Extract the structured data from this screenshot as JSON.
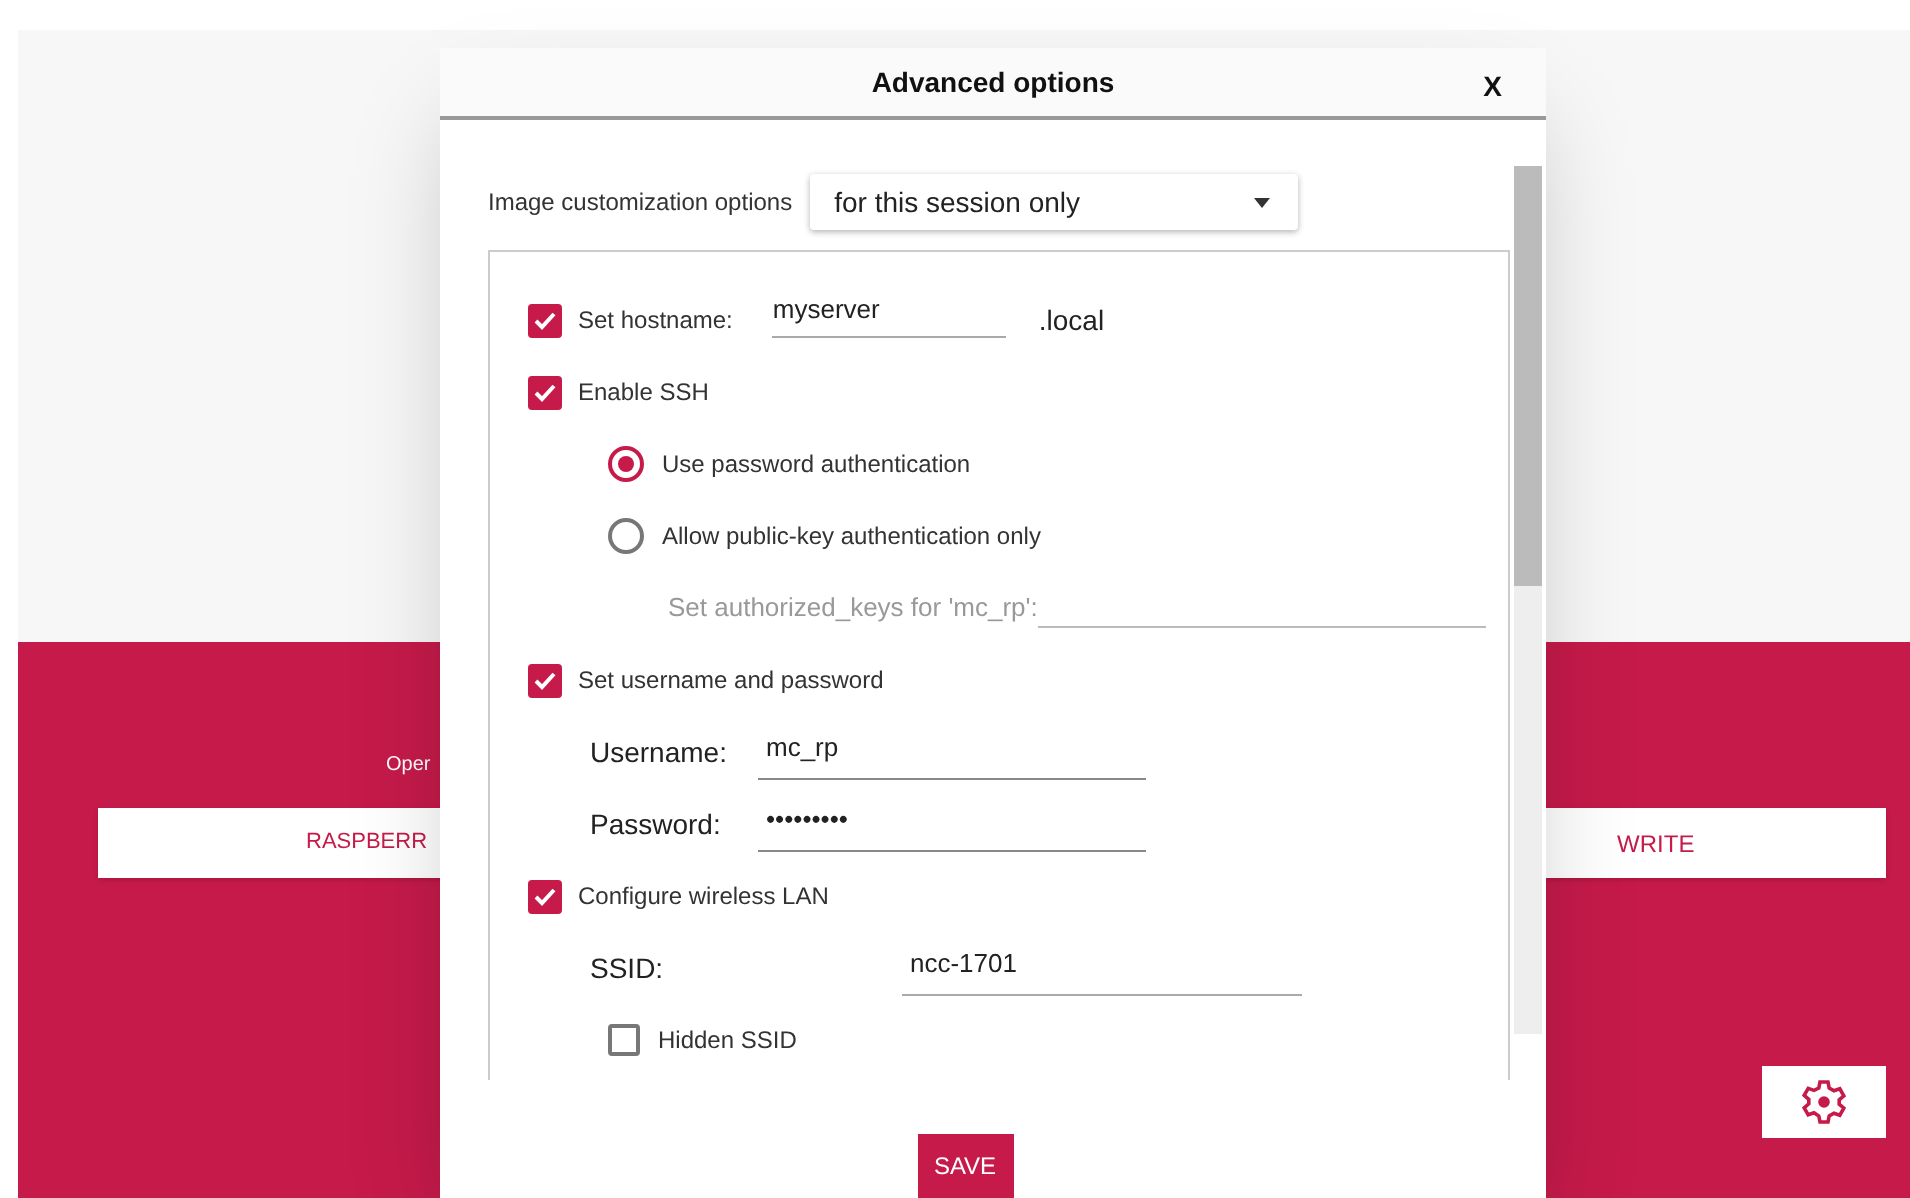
{
  "background": {
    "device_label": "Oper",
    "os_button": "RASPBERR",
    "write_button": "WRITE"
  },
  "dialog": {
    "title": "Advanced options",
    "close": "X",
    "customization": {
      "label": "Image customization options",
      "value": "for this session only"
    },
    "options": [
      {
        "kind": "checkbox",
        "label": "Set hostname:",
        "checked": true,
        "value": "myserver",
        "suffix": ".local"
      },
      {
        "kind": "checkbox",
        "label": "Enable SSH",
        "checked": true
      },
      {
        "kind": "radio",
        "label": "Use password authentication",
        "selected": true
      },
      {
        "kind": "radio",
        "label": "Allow public-key authentication only",
        "selected": false
      },
      {
        "kind": "keys",
        "label": "Set authorized_keys for 'mc_rp':"
      },
      {
        "kind": "checkbox",
        "label": "Set username and password",
        "checked": true
      },
      {
        "kind": "field",
        "label": "Username:",
        "value": "mc_rp"
      },
      {
        "kind": "field",
        "label": "Password:",
        "value": "•••••••••"
      },
      {
        "kind": "checkbox",
        "label": "Configure wireless LAN",
        "checked": true
      },
      {
        "kind": "wide_field",
        "label": "SSID:",
        "value": "ncc-1701"
      },
      {
        "kind": "small_checkbox",
        "label": "Hidden SSID",
        "checked": false
      }
    ],
    "save": "SAVE"
  }
}
